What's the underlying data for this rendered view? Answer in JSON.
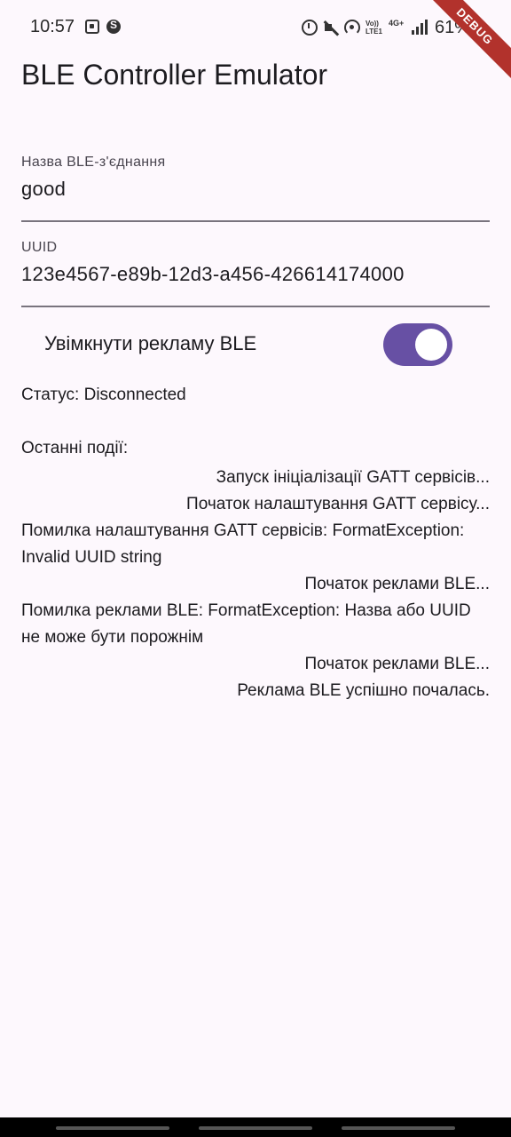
{
  "status_bar": {
    "time": "10:57",
    "volte": "Vo)) LTE1",
    "network": "4G+",
    "battery": "61%",
    "icons": [
      "sim-icon",
      "shazam-icon",
      "alarm-icon",
      "mute-icon",
      "hotspot-icon",
      "volte-icon",
      "4g-icon",
      "signal-icon"
    ]
  },
  "debug_banner": "DEBUG",
  "app_bar": {
    "title": "BLE Controller Emulator"
  },
  "form": {
    "name_label": "Назва BLE-з'єднання",
    "name_value": "good",
    "uuid_label": "UUID",
    "uuid_value": "123e4567-e89b-12d3-a456-426614174000"
  },
  "advertising": {
    "label": "Увімкнути рекламу BLE",
    "enabled": true,
    "accent": "#6750a4"
  },
  "status": "Статус: Disconnected",
  "events": {
    "title": "Останні події:",
    "entries": [
      "Запуск ініціалізації GATT сервісів...",
      "Початок налаштування GATT сервісу...",
      "Помилка налаштування GATT сервісів: FormatException: Invalid UUID string",
      "Початок реклами BLE...",
      "Помилка реклами BLE: FormatException: Назва або UUID не може бути порожнім",
      "Початок реклами BLE...",
      "Реклама BLE успішно почалась."
    ]
  }
}
